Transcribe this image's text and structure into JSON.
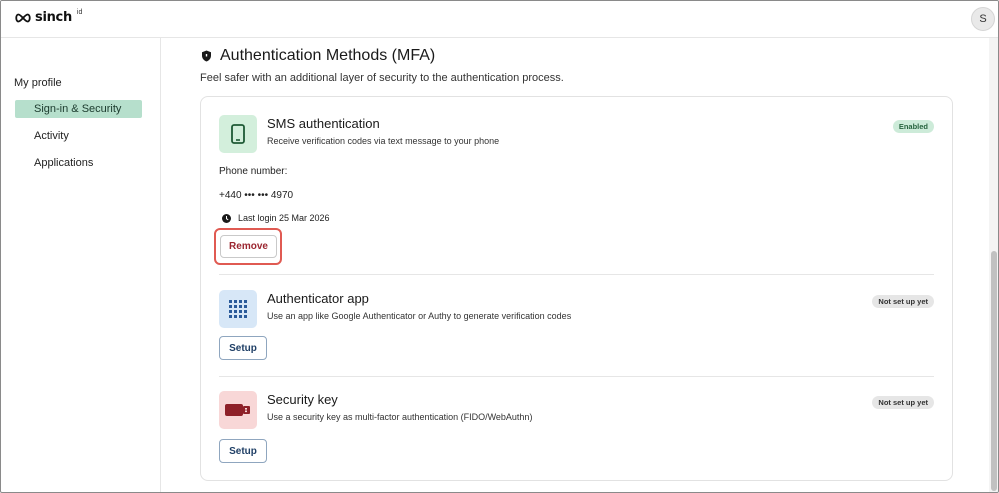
{
  "header": {
    "brand": "sinch",
    "brand_sup": "id",
    "avatar_initial": "S"
  },
  "sidebar": {
    "heading": "My profile",
    "items": [
      {
        "label": "Sign-in & Security",
        "active": true
      },
      {
        "label": "Activity",
        "active": false
      },
      {
        "label": "Applications",
        "active": false
      }
    ]
  },
  "section": {
    "title": "Authentication Methods (MFA)",
    "subtitle": "Feel safer with an additional layer of security to the authentication process.",
    "icon": "shield-icon"
  },
  "methods": [
    {
      "title": "SMS authentication",
      "description": "Receive verification codes via text message to your phone",
      "status": "Enabled",
      "icon": "phone-icon",
      "icon_bg": "#d3efdc",
      "phone_label": "Phone number:",
      "phone_value": "+440 ••• ••• 4970",
      "last_login": "Last login 25 Mar 2026",
      "action_label": "Remove"
    },
    {
      "title": "Authenticator app",
      "description": "Use an app like Google Authenticator or Authy to generate verification codes",
      "status": "Not set up yet",
      "icon": "keypad-grid-icon",
      "icon_bg": "#d7e7f7",
      "action_label": "Setup"
    },
    {
      "title": "Security key",
      "description": "Use a security key as multi-factor authentication (FIDO/WebAuthn)",
      "status": "Not set up yet",
      "icon": "usb-key-icon",
      "icon_bg": "#f8d7d7",
      "action_label": "Setup"
    }
  ],
  "colors": {
    "active_nav": "#b6dfcc",
    "enabled_badge": "#cdebd9",
    "remove_highlight": "#e05a52",
    "remove_text": "#9b2630",
    "setup_text": "#1f3f66"
  }
}
